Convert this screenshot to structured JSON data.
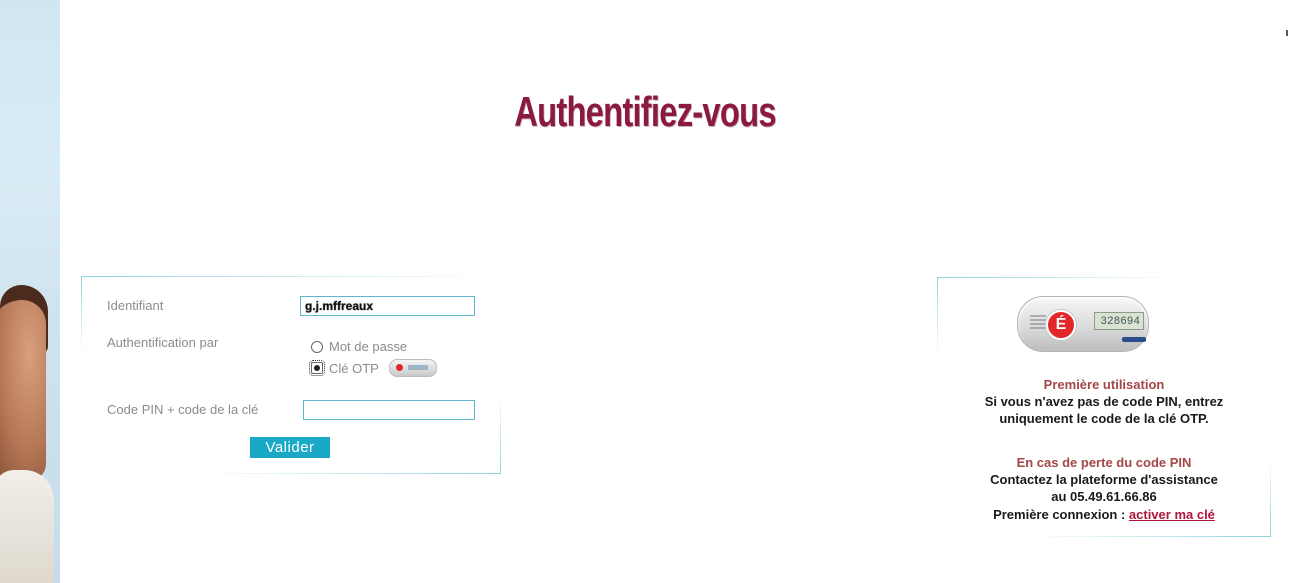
{
  "page": {
    "title": "Authentifiez-vous"
  },
  "login_form": {
    "identifiant_label": "Identifiant",
    "identifiant_value": "g.j.mffreaux",
    "auth_par_label": "Authentification par",
    "options": [
      {
        "label": "Mot de passe",
        "checked": false
      },
      {
        "label": "Clé OTP",
        "checked": true
      }
    ],
    "pin_label": "Code PIN + code de la clé",
    "pin_value": "",
    "submit_label": "Valider"
  },
  "otp_device": {
    "screen_value": "328694",
    "logo_letter": "É",
    "icon": "otp-token-icon"
  },
  "info_panel": {
    "first_use_heading": "Première utilisation",
    "first_use_text_1": "Si vous n'avez pas de code PIN, entrez",
    "first_use_text_2": "uniquement le code de la clé OTP.",
    "lost_pin_heading": "En cas de perte du code PIN",
    "contact_text": "Contactez la plateforme d'assistance",
    "phone_text": "au 05.49.61.66.86",
    "first_connection_prefix": "Première connexion :",
    "activate_link": "activer ma clé"
  },
  "colors": {
    "title": "#8b1a3e",
    "accent": "#1aa9c4",
    "maroon_heading": "#a24845",
    "link": "#b0173a"
  }
}
